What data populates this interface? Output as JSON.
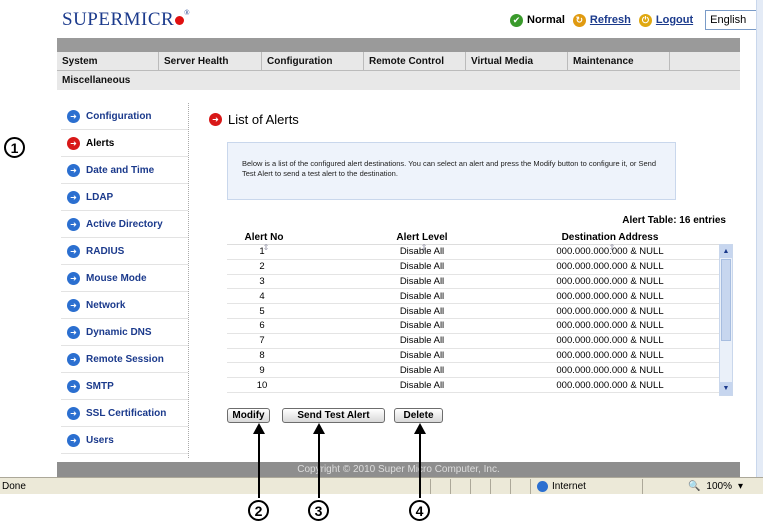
{
  "header": {
    "logo_text": "SUPERMICR",
    "logo_reg": "®",
    "status_label": "Normal",
    "refresh_label": "Refresh",
    "logout_label": "Logout",
    "language_selected": "English"
  },
  "nav": {
    "row1": [
      "System",
      "Server Health",
      "Configuration",
      "Remote Control",
      "Virtual Media",
      "Maintenance"
    ],
    "row2": [
      "Miscellaneous"
    ]
  },
  "sidebar": {
    "items": [
      {
        "label": "Configuration",
        "active": false
      },
      {
        "label": "Alerts",
        "active": true
      },
      {
        "label": "Date and Time",
        "active": false
      },
      {
        "label": "LDAP",
        "active": false
      },
      {
        "label": "Active Directory",
        "active": false
      },
      {
        "label": "RADIUS",
        "active": false
      },
      {
        "label": "Mouse Mode",
        "active": false
      },
      {
        "label": "Network",
        "active": false
      },
      {
        "label": "Dynamic DNS",
        "active": false
      },
      {
        "label": "Remote Session",
        "active": false
      },
      {
        "label": "SMTP",
        "active": false
      },
      {
        "label": "SSL Certification",
        "active": false
      },
      {
        "label": "Users",
        "active": false
      }
    ]
  },
  "main": {
    "title": "List of Alerts",
    "info_text": "Below is a list of the configured alert destinations. You can select an alert and press the Modify button to configure it, or Send Test Alert to send a test alert to the destination.",
    "table_caption": "Alert Table: 16 entries",
    "columns": [
      "Alert No",
      "Alert Level",
      "Destination Address"
    ],
    "rows": [
      [
        "1",
        "Disable All",
        "000.000.000.000 & NULL"
      ],
      [
        "2",
        "Disable All",
        "000.000.000.000 & NULL"
      ],
      [
        "3",
        "Disable All",
        "000.000.000.000 & NULL"
      ],
      [
        "4",
        "Disable All",
        "000.000.000.000 & NULL"
      ],
      [
        "5",
        "Disable All",
        "000.000.000.000 & NULL"
      ],
      [
        "6",
        "Disable All",
        "000.000.000.000 & NULL"
      ],
      [
        "7",
        "Disable All",
        "000.000.000.000 & NULL"
      ],
      [
        "8",
        "Disable All",
        "000.000.000.000 & NULL"
      ],
      [
        "9",
        "Disable All",
        "000.000.000.000 & NULL"
      ],
      [
        "10",
        "Disable All",
        "000.000.000.000 & NULL"
      ]
    ],
    "buttons": {
      "modify": "Modify",
      "send_test": "Send Test Alert",
      "delete": "Delete"
    }
  },
  "footer": {
    "copyright": "Copyright © 2010 Super Micro Computer, Inc."
  },
  "statusbar": {
    "done": "Done",
    "zone": "Internet",
    "zoom": "100%"
  },
  "callouts": [
    "1",
    "2",
    "3",
    "4"
  ],
  "colors": {
    "brand": "#1b3a8c",
    "active_arrow": "#d81818",
    "arrow": "#2b6fd0"
  }
}
